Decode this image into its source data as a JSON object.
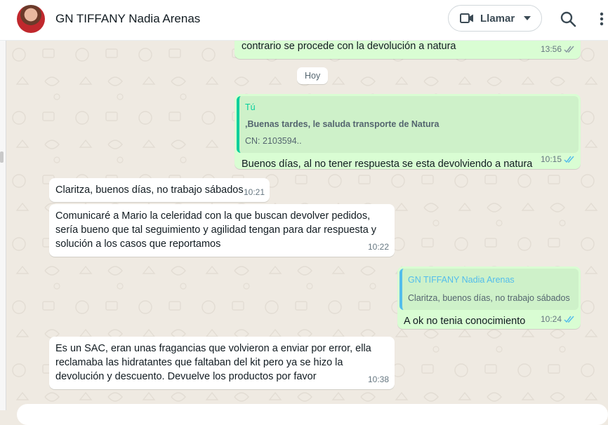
{
  "header": {
    "contact_name": "GN TIFFANY Nadia Arenas",
    "call_label": "Llamar"
  },
  "date_divider": "Hoy",
  "messages": [
    {
      "text": "contrario se procede con la devolución a natura",
      "time": "13:56",
      "status": "read"
    },
    {
      "quote_author": "Tú",
      "quote_line1": ",Buenas tardes, le saluda transporte de Natura",
      "quote_line2": "CN: 2103594..",
      "text": "Buenos días, al no tener respuesta se esta devolviendo a natura",
      "time": "10:15",
      "status": "read"
    },
    {
      "text": "Claritza, buenos días, no trabajo sábados",
      "time": "10:21"
    },
    {
      "text": "Comunicaré a Mario la celeridad con la que  buscan devolver pedidos, sería bueno que tal seguimiento y agilidad tengan para dar respuesta y solución a los casos que reportamos",
      "time": "10:22"
    },
    {
      "quote_author": "GN TIFFANY Nadia Arenas",
      "quote_line1": "Claritza, buenos días, no trabajo sábados",
      "text": "A ok no tenia conocimiento",
      "time": "10:24",
      "status": "read"
    },
    {
      "text": "Es un SAC, eran unas fragancias que volvieron a enviar por error, ella reclamaba las hidratantes que faltaban del kit pero ya se hizo la devolución y descuento. Devuelve los productos por favor",
      "time": "10:38"
    }
  ],
  "colors": {
    "outgoing_bubble": "#d9fdd3",
    "incoming_bubble": "#ffffff",
    "chat_background": "#efeae2",
    "read_ticks": "#53bdeb",
    "quote_accent_self": "#06cf9c",
    "quote_accent_contact": "#53bdeb"
  },
  "icons": [
    "video-camera-icon",
    "chevron-down-icon",
    "search-icon",
    "more-vertical-icon",
    "double-check-icon"
  ]
}
